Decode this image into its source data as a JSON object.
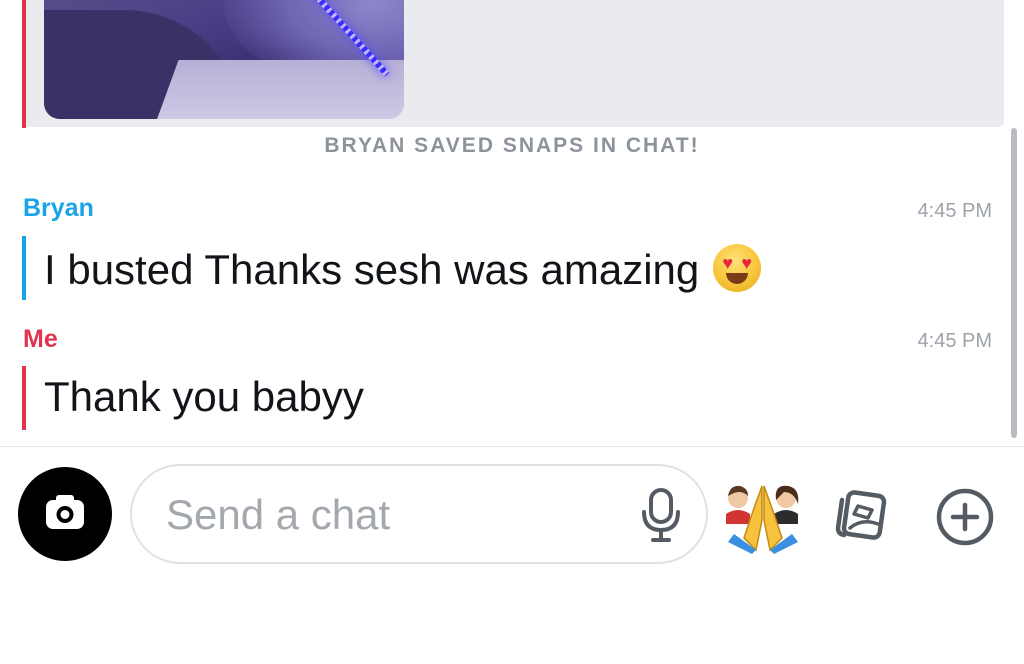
{
  "saved_snaps_notice": "BRYAN SAVED SNAPS IN CHAT!",
  "messages": [
    {
      "sender": "Bryan",
      "time": "4:45 PM",
      "text": "I busted Thanks sesh was amazing",
      "emoji": "heart-eyes-emoji",
      "color": "#1aa4e8"
    },
    {
      "sender": "Me",
      "time": "4:45 PM",
      "text": "Thank you babyy",
      "color": "#e2334d"
    }
  ],
  "composer": {
    "placeholder": "Send a chat",
    "value": ""
  },
  "icons": {
    "camera": "camera-icon",
    "mic": "microphone-icon",
    "bitmoji": "bitmoji-icon",
    "memories": "memories-icon",
    "plus": "plus-icon"
  },
  "colors": {
    "friend_accent": "#1aa4e8",
    "me_accent": "#e2334d",
    "saved_bg": "#e9ebef"
  }
}
